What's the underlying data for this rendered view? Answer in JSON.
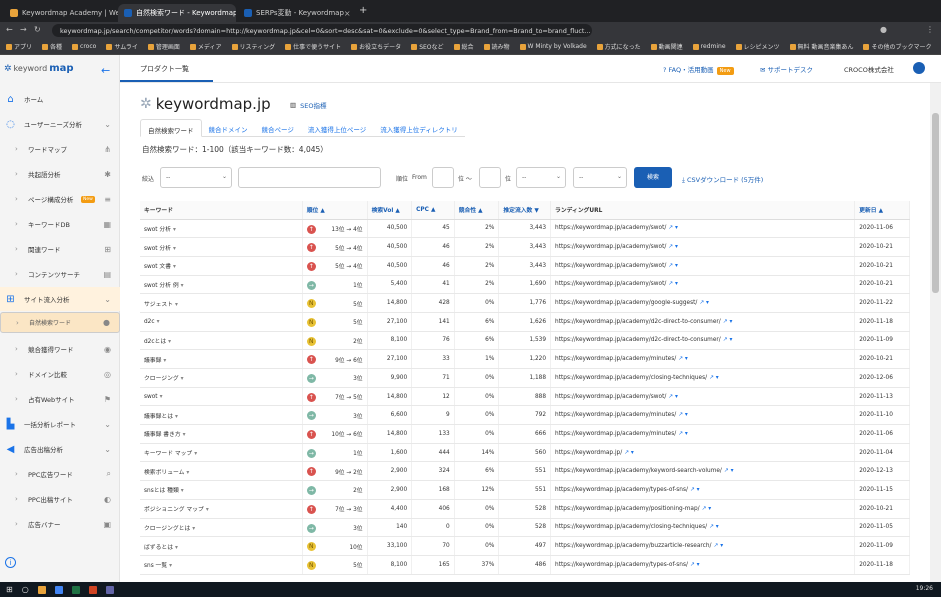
{
  "browser": {
    "tabs": [
      {
        "title": "Keywordmap Academy | WebマーケX",
        "color": "#e8a33b",
        "active": false
      },
      {
        "title": "自然検索ワード - Keywordmap",
        "color": "#1a5fb4",
        "active": true
      },
      {
        "title": "SERPs変動 - Keywordmap",
        "color": "#1a5fb4",
        "active": false
      }
    ],
    "new_tab": "+",
    "url": "keywordmap.jp/search/competitor/words?domain=http://keywordmap.jp&cel=0&sort=desc&sat=0&exclude=0&select_type=Brand_from=Brand_to=brand_fluct...",
    "bookmarks": [
      "アプリ",
      "各種",
      "croco",
      "サムライ",
      "管理画面",
      "メディア",
      "リスティング",
      "仕事で便うサイト",
      "お役立ちデータ",
      "SEOなど",
      "総合",
      "読み物",
      "W Minty by Volkade",
      "方式になった",
      "動画関連",
      "redmine",
      "レシピメンツ",
      "無料 動画音楽集あん",
      "その他のブックマーク"
    ]
  },
  "sidebar": {
    "logo_text": "keyword",
    "logo_bold": "map",
    "collapse_icon": "arrow-left-icon",
    "items": [
      {
        "label": "ホーム",
        "icon": "home-icon",
        "glyph": "⌂",
        "type": "main"
      },
      {
        "label": "ユーザーニーズ分析",
        "icon": "bulb-icon",
        "glyph": "◌",
        "type": "main",
        "right": "⌄"
      },
      {
        "label": "ワードマップ",
        "type": "sub",
        "right": "⋔"
      },
      {
        "label": "共起語分析",
        "type": "sub",
        "right": "✱"
      },
      {
        "label": "ページ構成分析",
        "type": "sub",
        "right": "≡",
        "badge": "New"
      },
      {
        "label": "キーワードDB",
        "type": "sub",
        "right": "▦"
      },
      {
        "label": "関連ワード",
        "type": "sub",
        "right": "⊞"
      },
      {
        "label": "コンテンツサーチ",
        "type": "sub",
        "right": "▤"
      },
      {
        "label": "サイト流入分析",
        "icon": "sitemap-icon",
        "glyph": "⊞",
        "type": "main",
        "right": "⌄",
        "highlight": true
      },
      {
        "label": "自然検索ワード",
        "type": "sub",
        "right": "●",
        "selected": true
      },
      {
        "label": "競合獲得ワード",
        "type": "sub",
        "right": "◉"
      },
      {
        "label": "ドメイン比較",
        "type": "sub",
        "right": "◎"
      },
      {
        "label": "占有Webサイト",
        "type": "sub",
        "right": "⚑"
      },
      {
        "label": "一括分析レポート",
        "icon": "chart-icon",
        "glyph": "▙",
        "type": "main",
        "right": "⌄"
      },
      {
        "label": "広告出稿分析",
        "icon": "megaphone-icon",
        "glyph": "◀",
        "type": "main",
        "right": "⌄"
      },
      {
        "label": "PPC広告ワード",
        "type": "sub",
        "right": "⌕"
      },
      {
        "label": "PPC出稿サイト",
        "type": "sub",
        "right": "◐"
      },
      {
        "label": "広告バナー",
        "type": "sub",
        "right": "▣"
      }
    ],
    "info_icon": "i"
  },
  "topbar": {
    "breadcrumb": "プロダクト一覧",
    "faq": "FAQ・活用動画",
    "faq_badge": "New",
    "support": "サポートデスク",
    "company": "CROCO株式会社"
  },
  "main": {
    "site": "keywordmap.jp",
    "seo_link": "SEO指標",
    "subtabs": [
      "自然検索ワード",
      "競合ドメイン",
      "競合ページ",
      "流入獲得上位ページ",
      "流入獲得上位ディレクトリ"
    ],
    "count_text": "自然検索ワード：1-100（該当キーワード数：4,045）",
    "filter": {
      "narrow_label": "絞込",
      "narrow_value": "--",
      "keyword_value": "",
      "rank_label": "順位",
      "from_label": "From",
      "range_sep": "位 〜",
      "to_unit": "位",
      "select2": "--",
      "select3": "--",
      "search_button": "検索",
      "csv": "CSVダウンロード (5万件)"
    },
    "columns": [
      "キーワード",
      "順位 ▲",
      "検索Vol ▲",
      "CPC ▲",
      "競合性 ▲",
      "推定流入数 ▼",
      "ランディングURL",
      "更新日 ▲"
    ],
    "rows": [
      {
        "kw": "swot 分析",
        "ind": "down",
        "rank": "13位 → 4位",
        "vol": "40,500",
        "cpc": "45",
        "comp": "2%",
        "flow": "3,443",
        "url": "https://keywordmap.jp/academy/swot/",
        "date": "2020-11-06"
      },
      {
        "kw": "swot 分析",
        "ind": "down",
        "rank": "5位 → 4位",
        "vol": "40,500",
        "cpc": "46",
        "comp": "2%",
        "flow": "3,443",
        "url": "https://keywordmap.jp/academy/swot/",
        "date": "2020-10-21"
      },
      {
        "kw": "swot 文書",
        "ind": "down",
        "rank": "5位 → 4位",
        "vol": "40,500",
        "cpc": "46",
        "comp": "2%",
        "flow": "3,443",
        "url": "https://keywordmap.jp/academy/swot/",
        "date": "2020-10-21"
      },
      {
        "kw": "swot 分析 例",
        "ind": "flat",
        "rank": "1位",
        "vol": "5,400",
        "cpc": "41",
        "comp": "2%",
        "flow": "1,690",
        "url": "https://keywordmap.jp/academy/swot/",
        "date": "2020-10-21"
      },
      {
        "kw": "サジェスト",
        "ind": "new",
        "rank": "5位",
        "vol": "14,800",
        "cpc": "428",
        "comp": "0%",
        "flow": "1,776",
        "url": "https://keywordmap.jp/academy/google-suggest/",
        "date": "2020-11-22"
      },
      {
        "kw": "d2c",
        "ind": "new",
        "rank": "5位",
        "vol": "27,100",
        "cpc": "141",
        "comp": "6%",
        "flow": "1,626",
        "url": "https://keywordmap.jp/academy/d2c-direct-to-consumer/",
        "date": "2020-11-18"
      },
      {
        "kw": "d2cとは",
        "ind": "new",
        "rank": "2位",
        "vol": "8,100",
        "cpc": "76",
        "comp": "6%",
        "flow": "1,539",
        "url": "https://keywordmap.jp/academy/d2c-direct-to-consumer/",
        "date": "2020-11-09"
      },
      {
        "kw": "議事録",
        "ind": "down",
        "rank": "9位 → 6位",
        "vol": "27,100",
        "cpc": "33",
        "comp": "1%",
        "flow": "1,220",
        "url": "https://keywordmap.jp/academy/minutes/",
        "date": "2020-10-21"
      },
      {
        "kw": "クロージング",
        "ind": "flat",
        "rank": "3位",
        "vol": "9,900",
        "cpc": "71",
        "comp": "0%",
        "flow": "1,188",
        "url": "https://keywordmap.jp/academy/closing-techniques/",
        "date": "2020-12-06"
      },
      {
        "kw": "swot",
        "ind": "down",
        "rank": "7位 → 5位",
        "vol": "14,800",
        "cpc": "12",
        "comp": "0%",
        "flow": "888",
        "url": "https://keywordmap.jp/academy/swot/",
        "date": "2020-11-13"
      },
      {
        "kw": "議事録とは",
        "ind": "flat",
        "rank": "3位",
        "vol": "6,600",
        "cpc": "9",
        "comp": "0%",
        "flow": "792",
        "url": "https://keywordmap.jp/academy/minutes/",
        "date": "2020-11-10"
      },
      {
        "kw": "議事録 書き方",
        "ind": "down",
        "rank": "10位 → 6位",
        "vol": "14,800",
        "cpc": "133",
        "comp": "0%",
        "flow": "666",
        "url": "https://keywordmap.jp/academy/minutes/",
        "date": "2020-11-06"
      },
      {
        "kw": "キーワード マップ",
        "ind": "flat",
        "rank": "1位",
        "vol": "1,600",
        "cpc": "444",
        "comp": "14%",
        "flow": "560",
        "url": "https://keywordmap.jp/",
        "date": "2020-11-04"
      },
      {
        "kw": "検索ボリューム",
        "ind": "down",
        "rank": "9位 → 2位",
        "vol": "2,900",
        "cpc": "324",
        "comp": "6%",
        "flow": "551",
        "url": "https://keywordmap.jp/academy/keyword-search-volume/",
        "date": "2020-12-13"
      },
      {
        "kw": "snsとは 種類",
        "ind": "flat",
        "rank": "2位",
        "vol": "2,900",
        "cpc": "168",
        "comp": "12%",
        "flow": "551",
        "url": "https://keywordmap.jp/academy/types-of-sns/",
        "date": "2020-11-15"
      },
      {
        "kw": "ポジショニング マップ",
        "ind": "down",
        "rank": "7位 → 3位",
        "vol": "4,400",
        "cpc": "406",
        "comp": "0%",
        "flow": "528",
        "url": "https://keywordmap.jp/academy/positioning-map/",
        "date": "2020-10-21"
      },
      {
        "kw": "クロージングとは",
        "ind": "flat",
        "rank": "3位",
        "vol": "140",
        "cpc": "0",
        "comp": "0%",
        "flow": "528",
        "url": "https://keywordmap.jp/academy/closing-techniques/",
        "date": "2020-11-05"
      },
      {
        "kw": "ばずるとは",
        "ind": "new",
        "rank": "10位",
        "vol": "33,100",
        "cpc": "70",
        "comp": "0%",
        "flow": "497",
        "url": "https://keywordmap.jp/academy/buzzarticle-research/",
        "date": "2020-11-09"
      },
      {
        "kw": "sns 一覧",
        "ind": "new",
        "rank": "5位",
        "vol": "8,100",
        "cpc": "165",
        "comp": "37%",
        "flow": "486",
        "url": "https://keywordmap.jp/academy/types-of-sns/",
        "date": "2020-11-18"
      }
    ]
  },
  "taskbar": {
    "clock": "19:26"
  },
  "colors": {
    "brand": "#1a5fb4",
    "accent": "#f39c12",
    "down": "#d9534f",
    "new": "#e8c235",
    "flat": "#7fb8a6"
  }
}
